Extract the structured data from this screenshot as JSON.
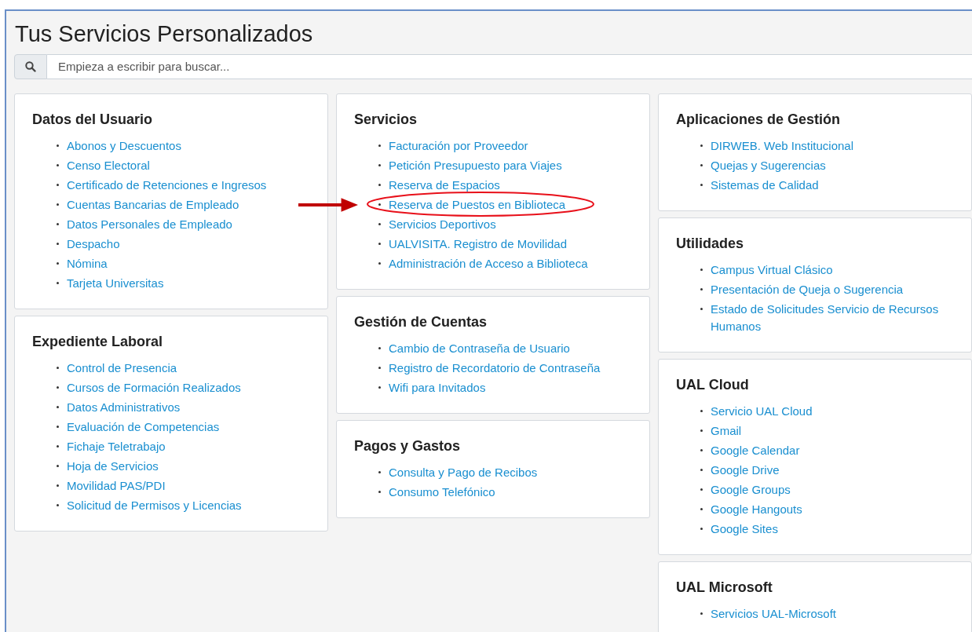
{
  "title": "Tus Servicios Personalizados",
  "search": {
    "placeholder": "Empieza a escribir para buscar..."
  },
  "columns": [
    {
      "cards": [
        {
          "title": "Datos del Usuario",
          "links": [
            {
              "label": "Abonos y Descuentos",
              "highlighted": false
            },
            {
              "label": "Censo Electoral",
              "highlighted": false
            },
            {
              "label": "Certificado de Retenciones e Ingresos",
              "highlighted": false
            },
            {
              "label": "Cuentas Bancarias de Empleado",
              "highlighted": false
            },
            {
              "label": "Datos Personales de Empleado",
              "highlighted": false
            },
            {
              "label": "Despacho",
              "highlighted": false
            },
            {
              "label": "Nómina",
              "highlighted": false
            },
            {
              "label": "Tarjeta Universitas",
              "highlighted": false
            }
          ]
        },
        {
          "title": "Expediente Laboral",
          "links": [
            {
              "label": "Control de Presencia",
              "highlighted": false
            },
            {
              "label": "Cursos de Formación Realizados",
              "highlighted": false
            },
            {
              "label": "Datos Administrativos",
              "highlighted": false
            },
            {
              "label": "Evaluación de Competencias",
              "highlighted": false
            },
            {
              "label": "Fichaje Teletrabajo",
              "highlighted": false
            },
            {
              "label": "Hoja de Servicios",
              "highlighted": false
            },
            {
              "label": "Movilidad PAS/PDI",
              "highlighted": false
            },
            {
              "label": "Solicitud de Permisos y Licencias",
              "highlighted": false
            }
          ]
        }
      ]
    },
    {
      "cards": [
        {
          "title": "Servicios",
          "links": [
            {
              "label": "Facturación por Proveedor",
              "highlighted": false
            },
            {
              "label": "Petición Presupuesto para Viajes",
              "highlighted": false
            },
            {
              "label": "Reserva de Espacios",
              "highlighted": false
            },
            {
              "label": "Reserva de Puestos en Biblioteca",
              "highlighted": true
            },
            {
              "label": "Servicios Deportivos",
              "highlighted": false
            },
            {
              "label": "UALVISITA. Registro de Movilidad",
              "highlighted": false
            },
            {
              "label": "Administración de Acceso a Biblioteca",
              "highlighted": false
            }
          ]
        },
        {
          "title": "Gestión de Cuentas",
          "links": [
            {
              "label": "Cambio de Contraseña de Usuario",
              "highlighted": false
            },
            {
              "label": "Registro de Recordatorio de Contraseña",
              "highlighted": false
            },
            {
              "label": "Wifi para Invitados",
              "highlighted": false
            }
          ]
        },
        {
          "title": "Pagos y Gastos",
          "links": [
            {
              "label": "Consulta y Pago de Recibos",
              "highlighted": false
            },
            {
              "label": "Consumo Telefónico",
              "highlighted": false
            }
          ]
        }
      ]
    },
    {
      "cards": [
        {
          "title": "Aplicaciones de Gestión",
          "links": [
            {
              "label": "DIRWEB. Web Institucional",
              "highlighted": false
            },
            {
              "label": "Quejas y Sugerencias",
              "highlighted": false
            },
            {
              "label": "Sistemas de Calidad",
              "highlighted": false
            }
          ]
        },
        {
          "title": "Utilidades",
          "links": [
            {
              "label": "Campus Virtual Clásico",
              "highlighted": false
            },
            {
              "label": "Presentación de Queja o Sugerencia",
              "highlighted": false
            },
            {
              "label": "Estado de Solicitudes Servicio de Recursos Humanos",
              "highlighted": false
            }
          ]
        },
        {
          "title": "UAL Cloud",
          "links": [
            {
              "label": "Servicio UAL Cloud",
              "highlighted": false
            },
            {
              "label": "Gmail",
              "highlighted": false
            },
            {
              "label": "Google Calendar",
              "highlighted": false
            },
            {
              "label": "Google Drive",
              "highlighted": false
            },
            {
              "label": "Google Groups",
              "highlighted": false
            },
            {
              "label": "Google Hangouts",
              "highlighted": false
            },
            {
              "label": "Google Sites",
              "highlighted": false
            }
          ]
        },
        {
          "title": "UAL Microsoft",
          "links": [
            {
              "label": "Servicios UAL-Microsoft",
              "highlighted": false
            }
          ]
        }
      ]
    }
  ]
}
